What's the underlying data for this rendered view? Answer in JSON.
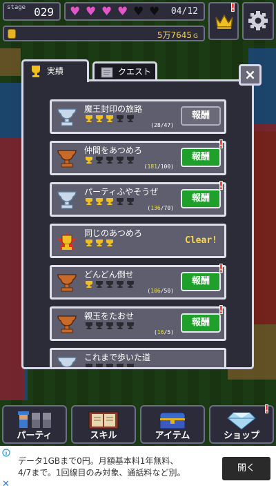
{
  "top_bar": {
    "stage_label": "stage",
    "stage_number": "029",
    "hearts_full": 4,
    "hearts_total": 6,
    "hp_count": "04/12",
    "gold_value": "5万7645",
    "gold_unit": "G"
  },
  "tabs": [
    {
      "label": "実績",
      "active": true,
      "icon": "trophy-icon"
    },
    {
      "label": "クエスト",
      "active": false,
      "icon": "scroll-icon"
    }
  ],
  "achievements": [
    {
      "title": "魔王封印の旅路",
      "trophy": "silver",
      "cups_gold": 3,
      "cups_total": 5,
      "progress_current": "28",
      "progress_target": "47",
      "status": "reward_disabled",
      "reward_label": "報酬",
      "alert": false
    },
    {
      "title": "仲間をあつめろ",
      "trophy": "bronze",
      "cups_gold": 1,
      "cups_total": 5,
      "progress_current": "181",
      "progress_target": "100",
      "status": "reward",
      "reward_label": "報酬",
      "alert": true
    },
    {
      "title": "パーティふやそうぜ",
      "trophy": "silver",
      "cups_gold": 3,
      "cups_total": 5,
      "progress_current": "136",
      "progress_target": "70",
      "status": "reward",
      "reward_label": "報酬",
      "alert": true
    },
    {
      "title": "同じのあつめろ",
      "trophy": "gold",
      "cups_gold": 3,
      "cups_total": 3,
      "progress_current": "",
      "progress_target": "",
      "status": "clear",
      "reward_label": "Clear!",
      "alert": false
    },
    {
      "title": "どんどん倒せ",
      "trophy": "bronze",
      "cups_gold": 1,
      "cups_total": 5,
      "progress_current": "106",
      "progress_target": "50",
      "status": "reward",
      "reward_label": "報酬",
      "alert": true
    },
    {
      "title": "親玉をたおせ",
      "trophy": "bronze",
      "cups_gold": 0,
      "cups_total": 5,
      "progress_current": "16",
      "progress_target": "5",
      "status": "reward",
      "reward_label": "報酬",
      "alert": true
    },
    {
      "title": "これまで歩いた道",
      "trophy": "silver",
      "cups_gold": 0,
      "cups_total": 5,
      "progress_current": "",
      "progress_target": "",
      "status": "partial",
      "reward_label": "",
      "alert": false
    }
  ],
  "close_label": "×",
  "bottom_nav": [
    {
      "label": "パーティ",
      "icon": "party-icon",
      "alert": false
    },
    {
      "label": "スキル",
      "icon": "skill-book-icon",
      "alert": false
    },
    {
      "label": "アイテム",
      "icon": "treasure-chest-icon",
      "alert": false
    },
    {
      "label": "ショップ",
      "icon": "diamond-icon",
      "alert": true
    }
  ],
  "ad": {
    "line1": "データ1GBまで0円。月額基本料1年無料、",
    "line2": "4/7まで。1回線目のみ対象、通話料など別。",
    "button": "開く"
  },
  "colors": {
    "heart_full": "#e356c8",
    "reward_green": "#1fa02a",
    "alert_red": "#ff2a2a",
    "clear_yellow": "#ffd64a"
  }
}
